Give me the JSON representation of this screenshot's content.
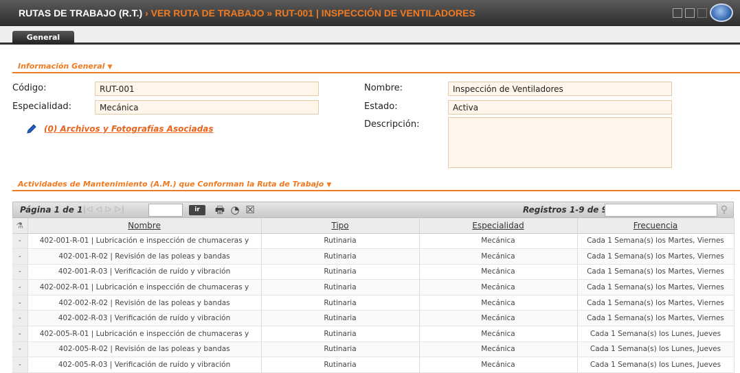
{
  "header": {
    "title_main": "RUTAS DE TRABAJO (R.T.)",
    "title_trail": " › VER RUTA DE TRABAJO » RUT-001 | INSPECCIÓN DE VENTILADORES"
  },
  "tabs": [
    {
      "label": "General"
    }
  ],
  "general_section": {
    "title": "Información General"
  },
  "form": {
    "codigo_label": "Código:",
    "codigo_value": "RUT-001",
    "especialidad_label": "Especialidad:",
    "especialidad_value": "Mecánica",
    "nombre_label": "Nombre:",
    "nombre_value": "Inspección de Ventiladores",
    "estado_label": "Estado:",
    "estado_value": "Activa",
    "descripcion_label": "Descripción:",
    "descripcion_value": ""
  },
  "attachments": {
    "link_text": "(0) Archivos y Fotografías Asociadas"
  },
  "activities_section": {
    "title": "Actividades de Mantenimiento (A.M.) que Conforman la Ruta de Trabajo"
  },
  "grid": {
    "page_label": "Página 1 de 1",
    "go_label": "ir",
    "records_label": "Registros 1-9 de 9",
    "columns": [
      "Nombre",
      "Tipo",
      "Especialidad",
      "Frecuencia"
    ],
    "rows": [
      {
        "marker": "-",
        "nombre": "402-001-R-01 | Lubricación e inspección de chumaceras y",
        "tipo": "Rutinaria",
        "especialidad": "Mecánica",
        "frecuencia": "Cada 1 Semana(s) los Martes, Viernes"
      },
      {
        "marker": "-",
        "nombre": "402-001-R-02 | Revisión de las poleas y bandas",
        "tipo": "Rutinaria",
        "especialidad": "Mecánica",
        "frecuencia": "Cada 1 Semana(s) los Martes, Viernes"
      },
      {
        "marker": "-",
        "nombre": "402-001-R-03 | Verificación de ruído y vibración",
        "tipo": "Rutinaria",
        "especialidad": "Mecánica",
        "frecuencia": "Cada 1 Semana(s) los Martes, Viernes"
      },
      {
        "marker": "-",
        "nombre": "402-002-R-01 | Lubricación e inspección de chumaceras y",
        "tipo": "Rutinaria",
        "especialidad": "Mecánica",
        "frecuencia": "Cada 1 Semana(s) los Martes, Viernes"
      },
      {
        "marker": "-",
        "nombre": "402-002-R-02 | Revisión de las poleas y bandas",
        "tipo": "Rutinaria",
        "especialidad": "Mecánica",
        "frecuencia": "Cada 1 Semana(s) los Martes, Viernes"
      },
      {
        "marker": "-",
        "nombre": "402-002-R-03 | Verificación de ruído y vibración",
        "tipo": "Rutinaria",
        "especialidad": "Mecánica",
        "frecuencia": "Cada 1 Semana(s) los Martes, Viernes"
      },
      {
        "marker": "-",
        "nombre": "402-005-R-01 | Lubricación e inspección de chumaceras y",
        "tipo": "Rutinaria",
        "especialidad": "Mecánica",
        "frecuencia": "Cada 1 Semana(s) los Lunes, Jueves"
      },
      {
        "marker": "-",
        "nombre": "402-005-R-02 | Revisión de las poleas y bandas",
        "tipo": "Rutinaria",
        "especialidad": "Mecánica",
        "frecuencia": "Cada 1 Semana(s) los Lunes, Jueves"
      },
      {
        "marker": "-",
        "nombre": "402-005-R-03 | Verificación de ruído y vibración",
        "tipo": "Rutinaria",
        "especialidad": "Mecánica",
        "frecuencia": "Cada 1 Semana(s) los Lunes, Jueves"
      }
    ]
  },
  "colors": {
    "accent": "#f07a21",
    "field_bg": "#fff5ea",
    "header_bg": "#3a3a3a"
  },
  "icons": [
    "layout-icon",
    "split-view-icon",
    "app-logo",
    "pencil-icon",
    "first-page-icon",
    "prev-page-icon",
    "next-page-icon",
    "last-page-icon",
    "print-icon",
    "chart-icon",
    "excel-icon",
    "search-icon",
    "filter-icon"
  ]
}
